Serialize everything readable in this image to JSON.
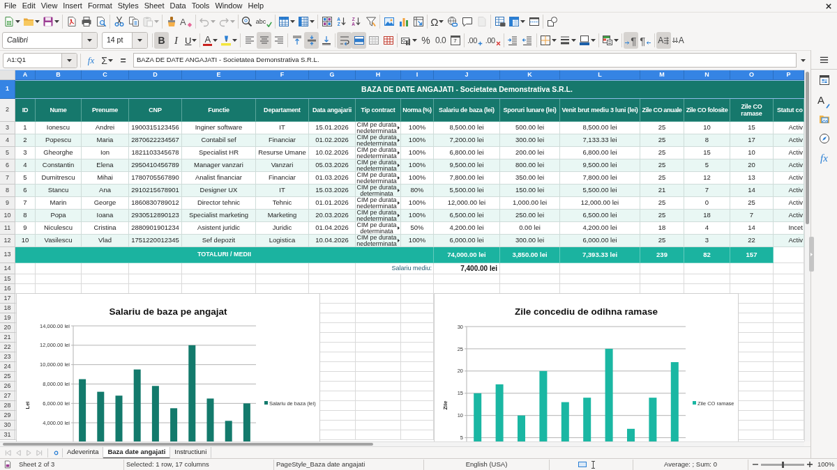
{
  "menu_bar": [
    "File",
    "Edit",
    "View",
    "Insert",
    "Format",
    "Styles",
    "Sheet",
    "Data",
    "Tools",
    "Window",
    "Help"
  ],
  "standard_toolbar": [
    [
      {
        "kind": "new",
        "dropdown": true,
        "disabled": false
      },
      {
        "kind": "open",
        "dropdown": true,
        "disabled": false
      },
      {
        "kind": "save",
        "dropdown": true,
        "disabled": false
      }
    ],
    [
      {
        "kind": "export",
        "dropdown": false,
        "disabled": false
      },
      {
        "kind": "print",
        "dropdown": false,
        "disabled": false
      },
      {
        "kind": "preview",
        "dropdown": false,
        "disabled": false
      }
    ],
    [
      {
        "kind": "cut",
        "dropdown": false,
        "disabled": false
      },
      {
        "kind": "copy",
        "dropdown": false,
        "disabled": false
      },
      {
        "kind": "paste",
        "dropdown": true,
        "disabled": true
      }
    ],
    [
      {
        "kind": "clone",
        "dropdown": false,
        "disabled": false
      },
      {
        "kind": "clear",
        "glyph": "A",
        "dropdown": false,
        "disabled": false
      }
    ],
    [
      {
        "kind": "undo",
        "dropdown": true,
        "disabled": true
      },
      {
        "kind": "redo",
        "dropdown": true,
        "disabled": true
      }
    ],
    [
      {
        "kind": "find",
        "dropdown": false,
        "disabled": false
      },
      {
        "kind": "spelling",
        "glyph": "abc",
        "dropdown": false,
        "disabled": false
      }
    ],
    [
      {
        "kind": "rows",
        "dropdown": true,
        "disabled": false
      },
      {
        "kind": "columns",
        "dropdown": true,
        "disabled": false
      }
    ],
    [
      {
        "kind": "sort",
        "dropdown": false,
        "disabled": false
      },
      {
        "kind": "ascending",
        "glyph": "A\nZ",
        "dropdown": false,
        "disabled": false
      },
      {
        "kind": "descending",
        "glyph": "Z\nA",
        "dropdown": false,
        "disabled": false
      },
      {
        "kind": "filter",
        "dropdown": false,
        "disabled": false
      }
    ],
    [
      {
        "kind": "image",
        "dropdown": false,
        "disabled": false
      },
      {
        "kind": "chart",
        "dropdown": false,
        "disabled": false
      },
      {
        "kind": "pivot",
        "dropdown": false,
        "disabled": false
      }
    ],
    [
      {
        "kind": "special",
        "glyph": "Ω",
        "dropdown": true,
        "disabled": false
      },
      {
        "kind": "hyperlink",
        "dropdown": false,
        "disabled": false
      },
      {
        "kind": "comment",
        "dropdown": false,
        "disabled": false
      },
      {
        "kind": "headers",
        "dropdown": false,
        "disabled": true
      }
    ],
    [
      {
        "kind": "printarea",
        "dropdown": false,
        "disabled": false
      },
      {
        "kind": "freeze",
        "dropdown": true,
        "disabled": false
      },
      {
        "kind": "split",
        "dropdown": false,
        "disabled": false
      }
    ],
    [
      {
        "kind": "shapes",
        "dropdown": false,
        "disabled": false
      }
    ]
  ],
  "formatting_toolbar": {
    "font": "Calibri",
    "size": "14 pt",
    "groups": [
      [
        {
          "kind": "bold",
          "glyph": "B",
          "selected": true,
          "dropdown": false
        },
        {
          "kind": "italic",
          "glyph": "I",
          "selected": false,
          "dropdown": false
        },
        {
          "kind": "underline",
          "glyph": "U",
          "selected": false,
          "dropdown": true
        }
      ],
      [
        {
          "kind": "fontcolor",
          "glyph": "A",
          "selected": false,
          "dropdown": true
        },
        {
          "kind": "highlight",
          "selected": false,
          "dropdown": true
        }
      ],
      [
        {
          "kind": "left",
          "selected": false,
          "dropdown": false
        },
        {
          "kind": "center",
          "selected": true,
          "dropdown": false
        },
        {
          "kind": "right",
          "selected": false,
          "dropdown": false
        }
      ],
      [
        {
          "kind": "top",
          "selected": false,
          "dropdown": false
        },
        {
          "kind": "middle",
          "selected": true,
          "dropdown": false
        },
        {
          "kind": "bottom",
          "selected": false,
          "dropdown": false
        }
      ],
      [
        {
          "kind": "wrap",
          "selected": true,
          "dropdown": false
        },
        {
          "kind": "mergecenter",
          "selected": true,
          "dropdown": false
        },
        {
          "kind": "merge",
          "selected": false,
          "dropdown": false
        },
        {
          "kind": "unmerge",
          "selected": false,
          "dropdown": false
        }
      ],
      [
        {
          "kind": "currency",
          "selected": false,
          "dropdown": true
        },
        {
          "kind": "percent",
          "glyph": "%",
          "selected": false,
          "dropdown": false
        },
        {
          "kind": "number",
          "glyph": "0.0",
          "selected": false,
          "dropdown": false
        },
        {
          "kind": "date",
          "glyph": "7",
          "selected": false,
          "dropdown": false
        }
      ],
      [
        {
          "kind": "adddecimal",
          "glyph": ".00",
          "selected": false,
          "dropdown": false
        },
        {
          "kind": "deletedecimal",
          "glyph": ".00",
          "selected": false,
          "dropdown": false
        }
      ],
      [
        {
          "kind": "indent",
          "selected": false,
          "dropdown": false
        },
        {
          "kind": "outdent",
          "selected": false,
          "dropdown": false
        }
      ],
      [
        {
          "kind": "borders",
          "selected": false,
          "dropdown": true
        },
        {
          "kind": "borderstyle",
          "selected": false,
          "dropdown": true
        },
        {
          "kind": "bordercolor",
          "selected": false,
          "dropdown": true
        }
      ],
      [
        {
          "kind": "conditional",
          "selected": false,
          "dropdown": true
        }
      ],
      [
        {
          "kind": "ltr",
          "glyph": "¶",
          "selected": true,
          "dropdown": false
        },
        {
          "kind": "rtl",
          "glyph": "¶",
          "selected": false,
          "dropdown": false
        }
      ],
      [
        {
          "kind": "horizontal",
          "glyph": "A",
          "selected": true,
          "dropdown": false
        },
        {
          "kind": "vertical",
          "glyph": "A",
          "selected": false,
          "dropdown": false
        }
      ]
    ]
  },
  "formula_bar": {
    "name_box": "A1:Q1",
    "buttons": [
      {
        "kind": "wizard",
        "glyph": "fx",
        "dropdown": false
      },
      {
        "kind": "sum",
        "glyph": "Σ",
        "dropdown": true
      },
      {
        "kind": "formula",
        "glyph": "=",
        "dropdown": false
      }
    ],
    "content": "BAZA DE DATE ANGAJATI - Societatea Demonstrativa S.R.L."
  },
  "sidebar": [
    {
      "kind": "properties"
    },
    {
      "kind": "styles",
      "glyph": "A"
    },
    {
      "kind": "gallery"
    },
    {
      "kind": "navigator"
    },
    {
      "kind": "functions",
      "glyph": "fx"
    }
  ],
  "sheet": {
    "column_headers": [
      {
        "label": "A",
        "selected": true
      },
      {
        "label": "B",
        "selected": true
      },
      {
        "label": "C",
        "selected": true
      },
      {
        "label": "D",
        "selected": true
      },
      {
        "label": "E",
        "selected": true
      },
      {
        "label": "F",
        "selected": true
      },
      {
        "label": "G",
        "selected": true
      },
      {
        "label": "H",
        "selected": true
      },
      {
        "label": "I",
        "selected": true
      },
      {
        "label": "J",
        "selected": true
      },
      {
        "label": "K",
        "selected": true
      },
      {
        "label": "L",
        "selected": true
      },
      {
        "label": "M",
        "selected": true
      },
      {
        "label": "N",
        "selected": true
      },
      {
        "label": "O",
        "selected": true
      },
      {
        "label": "P",
        "selected": true
      }
    ],
    "row_headers": [
      {
        "label": "1",
        "selected": true
      },
      {
        "label": "2",
        "selected": false
      },
      {
        "label": "3",
        "selected": false
      },
      {
        "label": "4",
        "selected": false
      },
      {
        "label": "5",
        "selected": false
      },
      {
        "label": "6",
        "selected": false
      },
      {
        "label": "7",
        "selected": false
      },
      {
        "label": "8",
        "selected": false
      },
      {
        "label": "9",
        "selected": false
      },
      {
        "label": "10",
        "selected": false
      },
      {
        "label": "11",
        "selected": false
      },
      {
        "label": "12",
        "selected": false
      },
      {
        "label": "13",
        "selected": false
      },
      {
        "label": "14",
        "selected": false
      },
      {
        "label": "15",
        "selected": false
      },
      {
        "label": "16",
        "selected": false
      },
      {
        "label": "17",
        "selected": false
      },
      {
        "label": "18",
        "selected": false
      },
      {
        "label": "19",
        "selected": false
      },
      {
        "label": "20",
        "selected": false
      },
      {
        "label": "21",
        "selected": false
      },
      {
        "label": "22",
        "selected": false
      },
      {
        "label": "23",
        "selected": false
      },
      {
        "label": "24",
        "selected": false
      },
      {
        "label": "25",
        "selected": false
      },
      {
        "label": "26",
        "selected": false
      },
      {
        "label": "27",
        "selected": false
      },
      {
        "label": "28",
        "selected": false
      },
      {
        "label": "29",
        "selected": false
      },
      {
        "label": "30",
        "selected": false
      },
      {
        "label": "31",
        "selected": false
      }
    ],
    "title": "BAZA DE DATE ANGAJATI - Societatea Demonstrativa S.R.L.",
    "columns": [
      "ID",
      "Nume",
      "Prenume",
      "CNP",
      "Functie",
      "Departament",
      "Data angajarii",
      "Tip contract",
      "Norma (%)",
      "Salariu de baza (lei)",
      "Sporuri lunare (lei)",
      "Venit brut mediu 3 luni (lei)",
      "Zile CO anuale",
      "Zile CO folosite",
      "Zile CO ramase",
      "Statut co"
    ],
    "rows": [
      [
        "1",
        "Ionescu",
        "Andrei",
        "1900315123456",
        "Inginer software",
        "IT",
        "15.01.2026",
        "CIM pe durata nedeterminata",
        "100%",
        "8,500.00 lei",
        "500.00 lei",
        "8,500.00 lei",
        "25",
        "10",
        "15",
        "Activ"
      ],
      [
        "2",
        "Popescu",
        "Maria",
        "2870622234567",
        "Contabil sef",
        "Financiar",
        "01.02.2026",
        "CIM pe durata nedeterminata",
        "100%",
        "7,200.00 lei",
        "300.00 lei",
        "7,133.33 lei",
        "25",
        "8",
        "17",
        "Activ"
      ],
      [
        "3",
        "Gheorghe",
        "Ion",
        "1821103345678",
        "Specialist HR",
        "Resurse Umane",
        "10.02.2026",
        "CIM pe durata nedeterminata",
        "100%",
        "6,800.00 lei",
        "200.00 lei",
        "6,800.00 lei",
        "25",
        "15",
        "10",
        "Activ"
      ],
      [
        "4",
        "Constantin",
        "Elena",
        "2950410456789",
        "Manager vanzari",
        "Vanzari",
        "05.03.2026",
        "CIM pe durata nedeterminata",
        "100%",
        "9,500.00 lei",
        "800.00 lei",
        "9,500.00 lei",
        "25",
        "5",
        "20",
        "Activ"
      ],
      [
        "5",
        "Dumitrescu",
        "Mihai",
        "1780705567890",
        "Analist financiar",
        "Financiar",
        "01.03.2026",
        "CIM pe durata nedeterminata",
        "100%",
        "7,800.00 lei",
        "350.00 lei",
        "7,800.00 lei",
        "25",
        "12",
        "13",
        "Activ"
      ],
      [
        "6",
        "Stancu",
        "Ana",
        "2910215678901",
        "Designer UX",
        "IT",
        "15.03.2026",
        "CIM pe durata determinata",
        "80%",
        "5,500.00 lei",
        "150.00 lei",
        "5,500.00 lei",
        "21",
        "7",
        "14",
        "Activ"
      ],
      [
        "7",
        "Marin",
        "George",
        "1860830789012",
        "Director tehnic",
        "Tehnic",
        "01.01.2026",
        "CIM pe durata nedeterminata",
        "100%",
        "12,000.00 lei",
        "1,000.00 lei",
        "12,000.00 lei",
        "25",
        "0",
        "25",
        "Activ"
      ],
      [
        "8",
        "Popa",
        "Ioana",
        "2930512890123",
        "Specialist marketing",
        "Marketing",
        "20.03.2026",
        "CIM pe durata nedeterminata",
        "100%",
        "6,500.00 lei",
        "250.00 lei",
        "6,500.00 lei",
        "25",
        "18",
        "7",
        "Activ"
      ],
      [
        "9",
        "Niculescu",
        "Cristina",
        "2880901901234",
        "Asistent juridic",
        "Juridic",
        "01.04.2026",
        "CIM pe durata determinata",
        "50%",
        "4,200.00 lei",
        "0.00 lei",
        "4,200.00 lei",
        "18",
        "4",
        "14",
        "Incet"
      ],
      [
        "10",
        "Vasilescu",
        "Vlad",
        "1751220012345",
        "Sef depozit",
        "Logistica",
        "10.04.2026",
        "CIM pe durata nedeterminata",
        "100%",
        "6,000.00 lei",
        "300.00 lei",
        "6,000.00 lei",
        "25",
        "3",
        "22",
        "Activ"
      ]
    ],
    "totals": {
      "label": "TOTALURI / MEDII",
      "values": [
        "74,000.00 lei",
        "3,850.00 lei",
        "7,393.33 lei",
        "239",
        "82",
        "157"
      ]
    },
    "average": {
      "label": "Salariu mediu:",
      "value": "7,400.00 lei"
    },
    "charts": [
      {
        "chart_data": {
          "type": "bar",
          "title": "Salariu de baza pe angajat",
          "ylabel": "Lei",
          "series": [
            {
              "name": "Salariu de baza (lei)",
              "color": "#137a6c",
              "values": [
                8500,
                7200,
                6800,
                9500,
                7800,
                5500,
                12000,
                6500,
                4200,
                6000
              ]
            }
          ],
          "ylim": [
            2000,
            14000
          ],
          "yticks": [
            {
              "value": 4000,
              "label": "4,000.00 lei"
            },
            {
              "value": 6000,
              "label": "6,000.00 lei"
            },
            {
              "value": 8000,
              "label": "8,000.00 lei"
            },
            {
              "value": 10000,
              "label": "10,000.00 lei"
            },
            {
              "value": 12000,
              "label": "12,000.00 lei"
            },
            {
              "value": 14000,
              "label": "14,000.00 lei"
            }
          ],
          "grid": true
        }
      },
      {
        "chart_data": {
          "type": "bar",
          "title": "Zile concediu de odihna ramase",
          "ylabel": "Zile",
          "series": [
            {
              "name": "Zile CO ramase",
              "color": "#1ab7a3",
              "values": [
                15,
                17,
                10,
                20,
                13,
                14,
                25,
                7,
                14,
                22
              ]
            }
          ],
          "ylim": [
            4,
            30
          ],
          "yticks": [
            5,
            10,
            15,
            20,
            25,
            30
          ],
          "grid": true
        }
      }
    ]
  },
  "sheet_tabs": [
    {
      "label": "Adeverinta",
      "selected": false
    },
    {
      "label": "Baza date angajati",
      "selected": true
    },
    {
      "label": "Instructiuni",
      "selected": false
    }
  ],
  "status_bar": {
    "sheet": "Sheet 2 of 3",
    "selection": "Selected: 1 row, 17 columns",
    "page_style": "PageStyle_Baza date angajati",
    "language": "English (USA)",
    "summary": "Average: ; Sum: 0",
    "zoom": {
      "level": 0.5,
      "reading": "100%"
    }
  }
}
